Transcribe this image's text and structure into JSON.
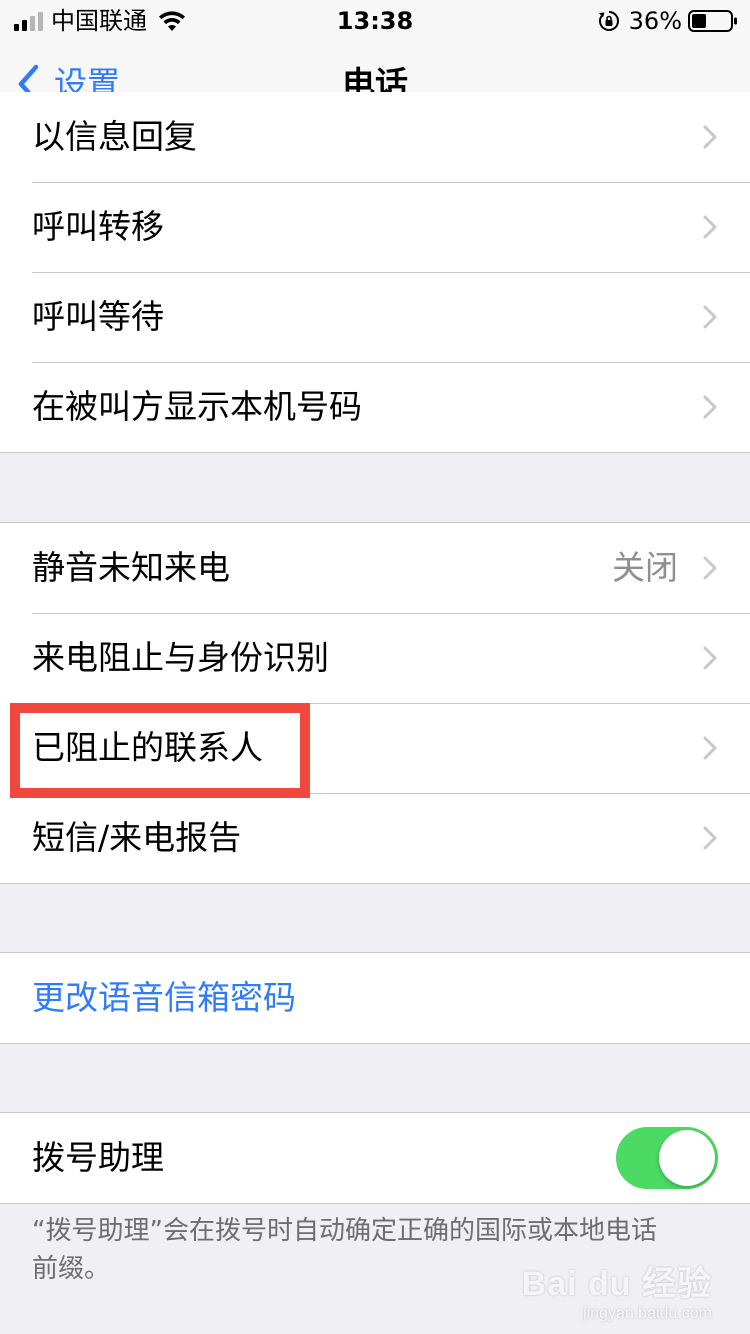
{
  "status_bar": {
    "carrier": "中国联通",
    "time": "13:38",
    "battery_percent": "36%"
  },
  "nav": {
    "back_label": "设置",
    "title": "电话"
  },
  "group1": {
    "items": [
      {
        "label": "以信息回复"
      },
      {
        "label": "呼叫转移"
      },
      {
        "label": "呼叫等待"
      },
      {
        "label": "在被叫方显示本机号码"
      }
    ]
  },
  "group2": {
    "items": [
      {
        "label": "静音未知来电",
        "value": "关闭"
      },
      {
        "label": "来电阻止与身份识别"
      },
      {
        "label": "已阻止的联系人"
      },
      {
        "label": "短信/来电报告"
      }
    ]
  },
  "group3": {
    "voicemail_label": "更改语音信箱密码"
  },
  "group4": {
    "dial_assist_label": "拨号助理",
    "dial_assist_on": true
  },
  "footer": {
    "note": "“拨号助理”会在拨号时自动确定正确的国际或本地电话前缀。"
  },
  "watermark": {
    "main": "Bai du 经验",
    "sub": "jingyan.baidu.com"
  },
  "colors": {
    "accent": "#2f7cf6",
    "toggle_on": "#4cd964",
    "highlight": "#f0473f"
  }
}
